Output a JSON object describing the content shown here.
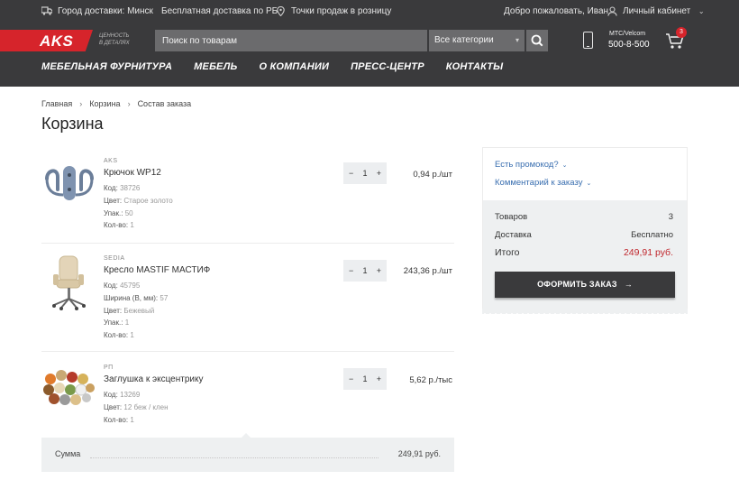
{
  "header": {
    "city_label": "Город доставки: Минск",
    "free_delivery": "Бесплатная доставка по РБ",
    "retail_points": "Точки продаж в розницу",
    "welcome": "Добро пожаловать, Иван",
    "account": "Личный кабинет",
    "logo_text": "AKS",
    "slogan_line1": "ценность",
    "slogan_line2": "в деталях",
    "search_placeholder": "Поиск по товарам",
    "category_select": "Все категории",
    "phone_operators": "МТС/Velcom",
    "phone_number": "500-8-500",
    "cart_count": "3",
    "brand_color": "#d6242b"
  },
  "nav": [
    "Мебельная фурнитура",
    "Мебель",
    "О компании",
    "Пресс-центр",
    "Контакты"
  ],
  "breadcrumb": [
    "Главная",
    "Корзина",
    "Состав заказа"
  ],
  "page_title": "Корзина",
  "items": [
    {
      "brand": "AKS",
      "name": "Крючок WP12",
      "attrs": [
        {
          "label": "Код:",
          "value": "38726"
        },
        {
          "label": "Цвет:",
          "value": "Старое золото"
        },
        {
          "label": "Упак.:",
          "value": "50"
        },
        {
          "label": "Кол-во:",
          "value": "1"
        }
      ],
      "qty": "1",
      "price": "0,94 р./шт"
    },
    {
      "brand": "SEDIA",
      "name": "Кресло MASTIF МАСТИФ",
      "attrs": [
        {
          "label": "Код:",
          "value": "45795"
        },
        {
          "label": "Ширина (В, мм):",
          "value": "57"
        },
        {
          "label": "Цвет:",
          "value": "Бежевый"
        },
        {
          "label": "Упак.:",
          "value": "1"
        },
        {
          "label": "Кол-во:",
          "value": "1"
        }
      ],
      "qty": "1",
      "price": "243,36 р./шт"
    },
    {
      "brand": "РП",
      "name": "Заглушка к эксцентрику",
      "attrs": [
        {
          "label": "Код:",
          "value": "13269"
        },
        {
          "label": "Цвет:",
          "value": "12 беж / клен"
        },
        {
          "label": "Кол-во:",
          "value": "1"
        }
      ],
      "qty": "1",
      "price": "5,62 р./тыс"
    }
  ],
  "qty_minus": "−",
  "qty_plus": "+",
  "sum": {
    "label": "Сумма",
    "value": "249,91 руб."
  },
  "summary": {
    "promo_link": "Есть промокод?",
    "comment_link": "Комментарий к заказу",
    "goods_label": "Товаров",
    "goods_value": "3",
    "delivery_label": "Доставка",
    "delivery_value": "Бесплатно",
    "total_label": "Итого",
    "total_value": "249,91 руб.",
    "order_button": "Оформить заказ",
    "total_color": "#c0272d"
  }
}
